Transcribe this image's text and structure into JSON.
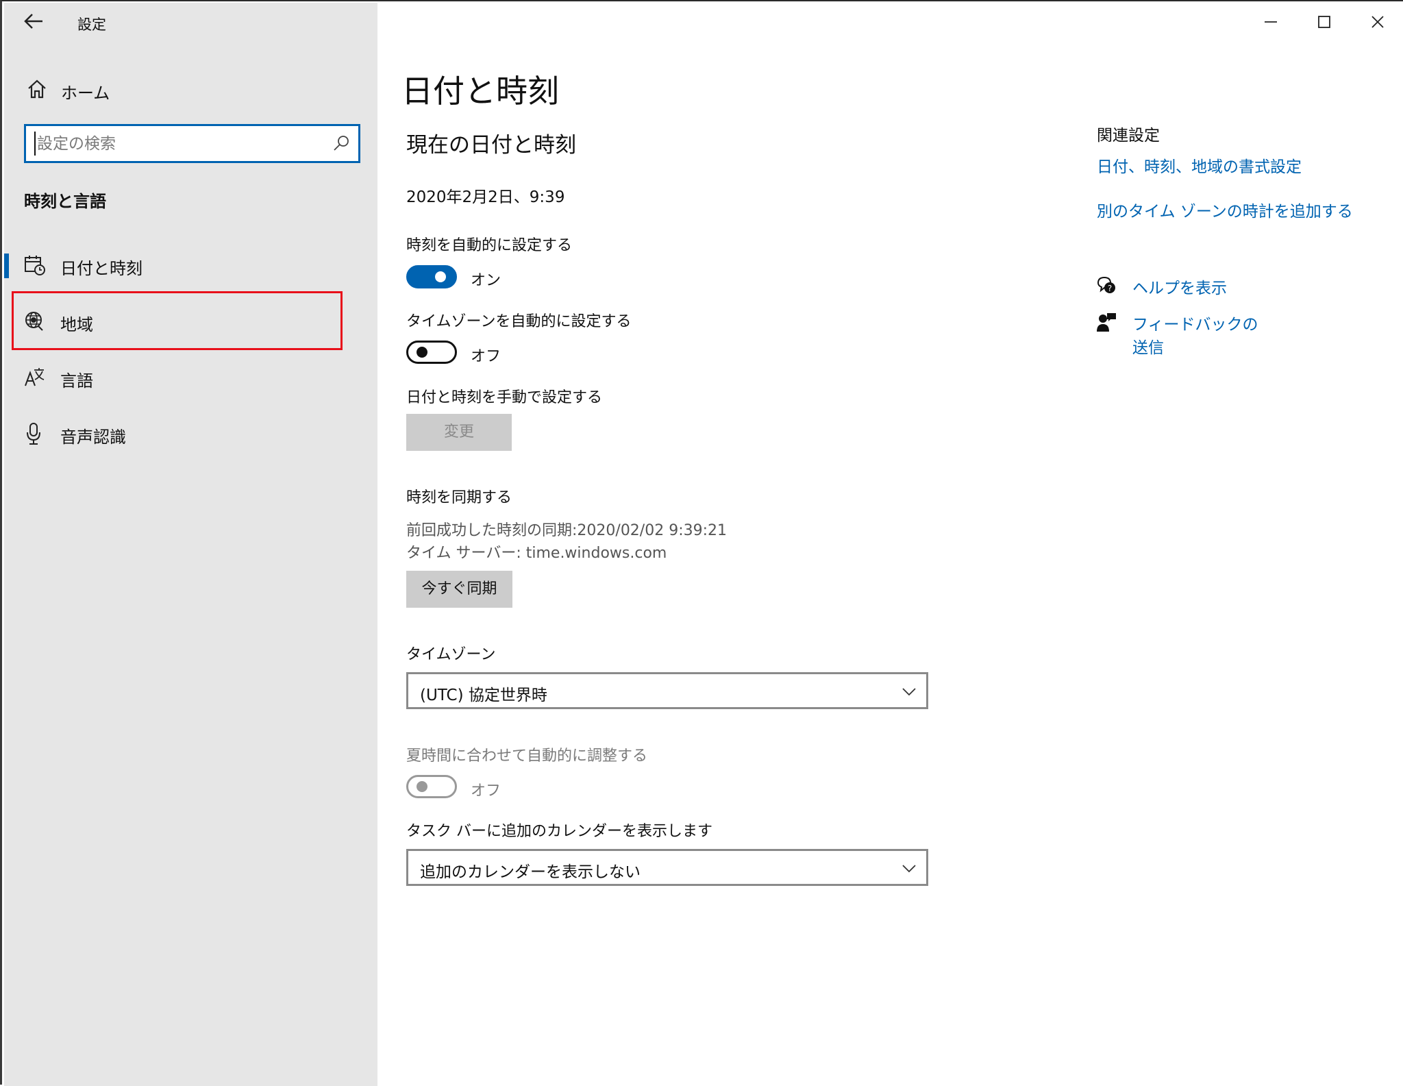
{
  "window": {
    "title": "設定",
    "back_icon": "back-arrow-icon",
    "controls": {
      "minimize": "—",
      "maximize": "☐",
      "close": "✕"
    }
  },
  "sidebar": {
    "home_label": "ホーム",
    "search_placeholder": "設定の検索",
    "search_value": "",
    "section_heading": "時刻と言語",
    "items": [
      {
        "label": "日付と時刻",
        "icon": "calendar-clock-icon",
        "selected": true
      },
      {
        "label": "地域",
        "icon": "globe-icon",
        "selected": false
      },
      {
        "label": "言語",
        "icon": "language-icon",
        "selected": false
      },
      {
        "label": "音声認識",
        "icon": "microphone-icon",
        "selected": false
      }
    ]
  },
  "main": {
    "title": "日付と時刻",
    "current_heading": "現在の日付と時刻",
    "current_datetime": "2020年2月2日、9:39",
    "auto_time": {
      "label": "時刻を自動的に設定する",
      "state": "オン",
      "on": true
    },
    "auto_timezone": {
      "label": "タイムゾーンを自動的に設定する",
      "state": "オフ",
      "on": false
    },
    "manual": {
      "label": "日付と時刻を手動で設定する",
      "button": "変更"
    },
    "sync": {
      "label": "時刻を同期する",
      "last_sync": "前回成功した時刻の同期:2020/02/02 9:39:21",
      "server": "タイム サーバー: time.windows.com",
      "button": "今すぐ同期"
    },
    "timezone": {
      "label": "タイムゾーン",
      "value": "(UTC) 協定世界時"
    },
    "dst": {
      "label": "夏時間に合わせて自動的に調整する",
      "state": "オフ",
      "enabled": false
    },
    "calendar": {
      "label": "タスク バーに追加のカレンダーを表示します",
      "value": "追加のカレンダーを表示しない"
    }
  },
  "related": {
    "heading": "関連設定",
    "links": [
      "日付、時刻、地域の書式設定",
      "別のタイム ゾーンの時計を追加する"
    ],
    "help": "ヘルプを表示",
    "feedback": "フィードバックの送信"
  },
  "colors": {
    "accent": "#0063b1",
    "sidebar_bg": "#e6e6e6",
    "highlight": "#e8101a"
  }
}
